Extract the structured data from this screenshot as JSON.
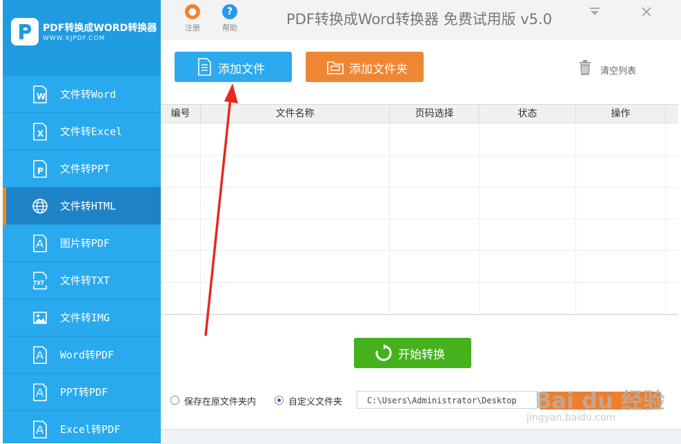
{
  "app": {
    "name": "PDF转换成WORD转换器",
    "url": "WWW.XJPDF.COM",
    "title": "PDF转换成Word转换器 免费试用版 v5.0"
  },
  "colors": {
    "sidebar": "#29a9ee",
    "sidebar_active": "#1e82c6",
    "active_indicator": "#f08a1c",
    "add_file": "#2da9f0",
    "add_folder": "#ef8634",
    "start": "#45b11d",
    "register_icon": "#f0842c",
    "help_icon": "#2a98e8",
    "arrow": "#e8281f"
  },
  "toolbar": {
    "register_label": "注册",
    "help_label": "帮助"
  },
  "sidebar": {
    "items": [
      {
        "label": "文件转Word",
        "icon": "word-doc-icon"
      },
      {
        "label": "文件转Excel",
        "icon": "excel-doc-icon"
      },
      {
        "label": "文件转PPT",
        "icon": "ppt-doc-icon"
      },
      {
        "label": "文件转HTML",
        "icon": "globe-icon",
        "active": true
      },
      {
        "label": "图片转PDF",
        "icon": "pdf-doc-icon"
      },
      {
        "label": "文件转TXT",
        "icon": "txt-doc-icon"
      },
      {
        "label": "文件转IMG",
        "icon": "image-icon"
      },
      {
        "label": "Word转PDF",
        "icon": "pdf-doc-icon"
      },
      {
        "label": "PPT转PDF",
        "icon": "pdf-doc-icon"
      },
      {
        "label": "Excel转PDF",
        "icon": "pdf-doc-icon"
      }
    ]
  },
  "main": {
    "add_file_label": "添加文件",
    "add_folder_label": "添加文件夹",
    "clear_list_label": "清空列表",
    "table": {
      "columns": [
        "编号",
        "文件名称",
        "页码选择",
        "状态",
        "操作"
      ],
      "rows": []
    },
    "start_label": "开始转换",
    "save_options": {
      "original_folder_label": "保存在原文件夹内",
      "custom_folder_label": "自定义文件夹",
      "selected": "custom_folder",
      "path_value": "C:\\Users\\Administrator\\Desktop"
    }
  },
  "watermark": {
    "text": "Bai du 经验",
    "sub": "jingyan.baidu.com"
  }
}
